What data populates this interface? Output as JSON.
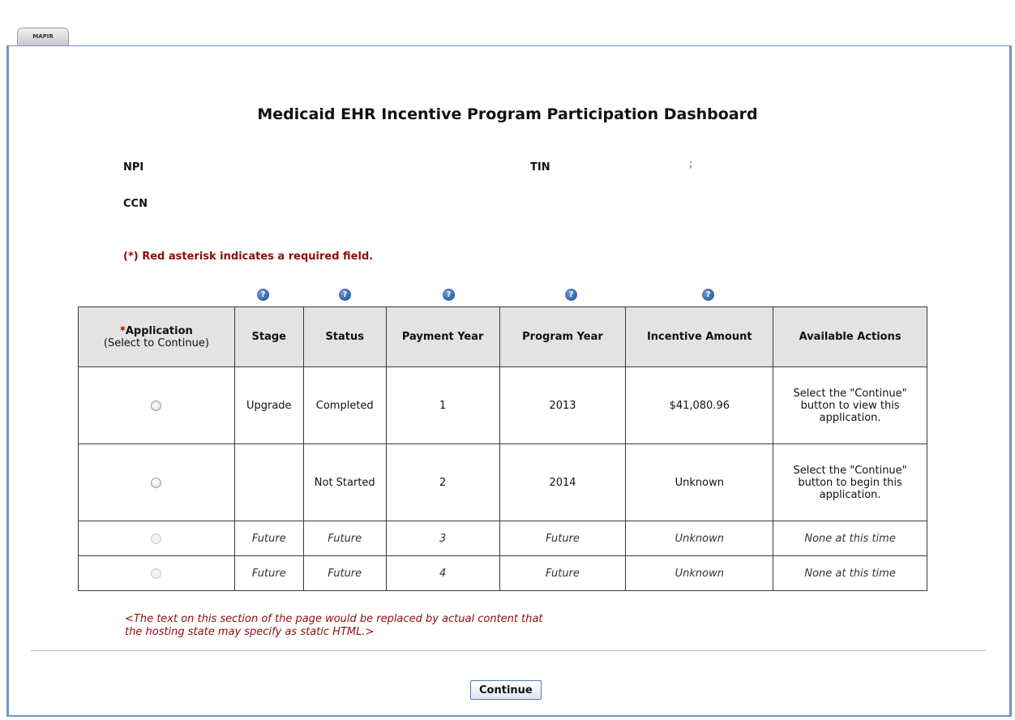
{
  "tab": {
    "label": "MAPIR"
  },
  "page": {
    "title": "Medicaid EHR Incentive Program Participation Dashboard"
  },
  "ids": {
    "npi_label": "NPI",
    "tin_label": "TIN",
    "tin_value": ";",
    "ccn_label": "CCN"
  },
  "required_note": "(*) Red asterisk indicates a required field.",
  "help_icon": "question-circle-icon",
  "table": {
    "headers": {
      "application_asterisk": "*",
      "application": "Application",
      "application_sub": "(Select to Continue)",
      "stage": "Stage",
      "status": "Status",
      "payment_year": "Payment Year",
      "program_year": "Program Year",
      "incentive_amount": "Incentive Amount",
      "available_actions": "Available Actions"
    },
    "rows": [
      {
        "stage": "Upgrade",
        "status": "Completed",
        "payment_year": "1",
        "program_year": "2013",
        "incentive_amount": "$41,080.96",
        "actions": "Select the \"Continue\" button to view this application."
      },
      {
        "stage": "",
        "status": "Not Started",
        "payment_year": "2",
        "program_year": "2014",
        "incentive_amount": "Unknown",
        "actions": "Select the \"Continue\" button to begin this application."
      },
      {
        "stage": "Future",
        "status": "Future",
        "payment_year": "3",
        "program_year": "Future",
        "incentive_amount": "Unknown",
        "actions": "None at this time"
      },
      {
        "stage": "Future",
        "status": "Future",
        "payment_year": "4",
        "program_year": "Future",
        "incentive_amount": "Unknown",
        "actions": "None at this time"
      }
    ]
  },
  "static_note": "<The text on this section of the page would be replaced by actual content that the hosting state may specify as static HTML.>",
  "continue_button": "Continue",
  "colors": {
    "frame": "#6f96c9",
    "required": "#8b0d0d",
    "header_bg": "#e3e3e3"
  }
}
